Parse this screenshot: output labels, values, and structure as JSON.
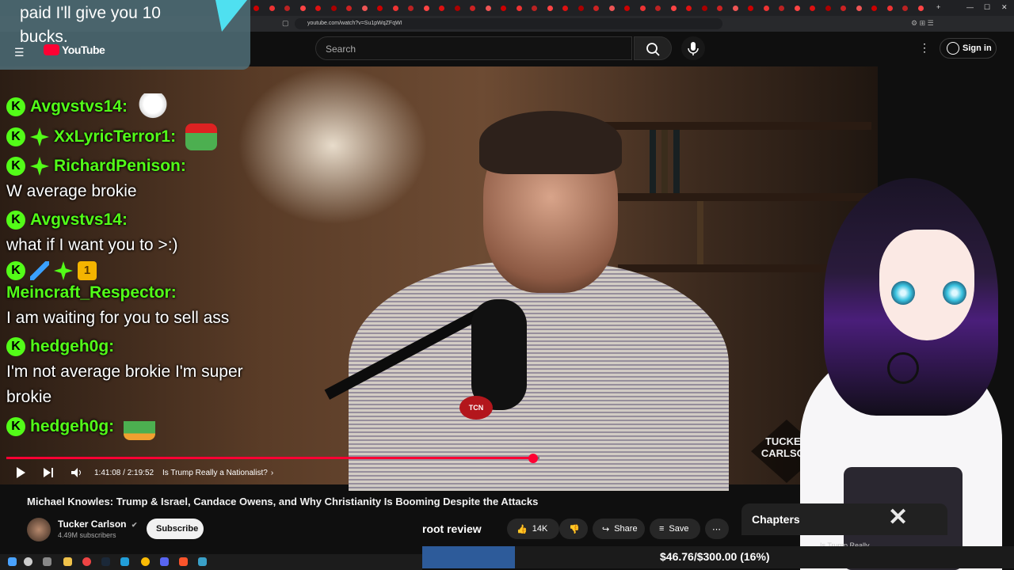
{
  "browser": {
    "url": "youtube.com/watch?v=Su1pWqZFqWI",
    "tab_count": 44
  },
  "youtube": {
    "logo_text": "YouTube",
    "search_placeholder": "Search",
    "signin_label": "Sign in"
  },
  "chat": {
    "top_message": "paid I'll give you 10 bucks.",
    "messages": [
      {
        "user": "Avgvstvs14:",
        "text": "",
        "badges": [
          "kick"
        ],
        "emote": "goose"
      },
      {
        "user": "XxLyricTerror1:",
        "text": "",
        "badges": [
          "kick",
          "gifter"
        ],
        "emote": "pepe-santa"
      },
      {
        "user": "RichardPenison:",
        "text": "W average brokie",
        "badges": [
          "kick",
          "gifter"
        ]
      },
      {
        "user": "Avgvstvs14:",
        "text": "what if I want you to >:)",
        "badges": [
          "kick"
        ]
      },
      {
        "user": "Meincraft_Respector:",
        "text": "I am waiting for you to sell ass",
        "badges": [
          "kick",
          "sword",
          "gifter",
          "one"
        ]
      },
      {
        "user": "hedgeh0g:",
        "text": "I'm not average brokie I'm super brokie",
        "badges": [
          "kick"
        ]
      },
      {
        "user": "hedgeh0g:",
        "text": "",
        "badges": [
          "kick"
        ],
        "emote": "pepe-lying"
      }
    ],
    "badge_one_text": "1",
    "kick_badge_text": "K"
  },
  "player": {
    "time": "1:41:08 / 2:19:52",
    "chapter": "Is Trump Really a Nationalist?",
    "progress": 0.723,
    "mic_tag": "TCN",
    "watermark": "TUCKER CARLSON"
  },
  "video": {
    "title": "Michael Knowles: Trump & Israel, Candace Owens, and Why Christianity Is Booming Despite the Attacks",
    "channel": "Tucker Carlson",
    "subscribers": "4.49M subscribers",
    "subscribe_label": "Subscribe",
    "likes": "14K",
    "share_label": "Share",
    "save_label": "Save",
    "chapters_label": "Chapters",
    "chapter_preview": "Is Trump Really..."
  },
  "overlay": {
    "root_review": "root review",
    "goal_text": "$46.76/$300.00 (16%)",
    "goal_fraction": 0.156
  },
  "colors": {
    "kick_green": "#53fc18",
    "yt_red": "#ff0033",
    "goal_blue": "#2d5b9a"
  }
}
